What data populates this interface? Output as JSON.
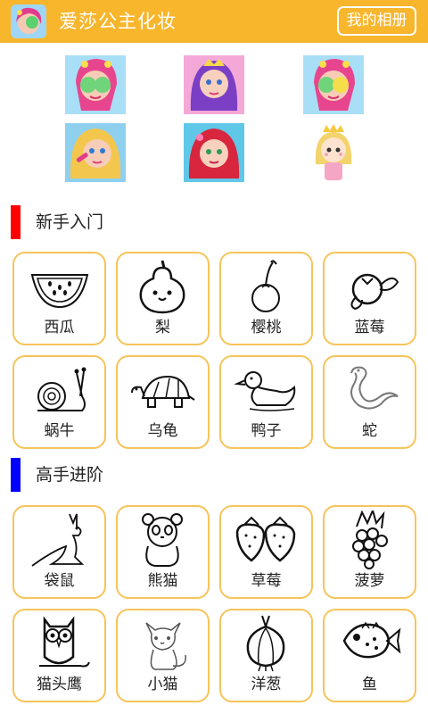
{
  "header": {
    "title": "爱莎公主化妆",
    "album_button": "我的相册"
  },
  "gallery": {
    "thumbnails": [
      {
        "name": "princess-mask-1",
        "icon": "face-mask-princess-icon"
      },
      {
        "name": "princess-purple",
        "icon": "purple-hair-princess-icon"
      },
      {
        "name": "princess-mask-2",
        "icon": "face-mask-princess-icon"
      },
      {
        "name": "princess-makeup",
        "icon": "makeup-princess-icon"
      },
      {
        "name": "princess-red",
        "icon": "red-hair-princess-icon"
      },
      {
        "name": "princess-cartoon",
        "icon": "cartoon-princess-icon"
      }
    ]
  },
  "sections": [
    {
      "title": "新手入门",
      "color": "#ff0000",
      "items": [
        {
          "label": "西瓜",
          "icon": "watermelon-icon"
        },
        {
          "label": "梨",
          "icon": "pear-icon"
        },
        {
          "label": "樱桃",
          "icon": "cherry-icon"
        },
        {
          "label": "蓝莓",
          "icon": "blueberry-icon"
        },
        {
          "label": "蜗牛",
          "icon": "snail-icon"
        },
        {
          "label": "乌龟",
          "icon": "turtle-icon"
        },
        {
          "label": "鸭子",
          "icon": "duck-icon"
        },
        {
          "label": "蛇",
          "icon": "snake-icon"
        }
      ]
    },
    {
      "title": "高手进阶",
      "color": "#0000ff",
      "items": [
        {
          "label": "袋鼠",
          "icon": "kangaroo-icon"
        },
        {
          "label": "熊猫",
          "icon": "panda-icon"
        },
        {
          "label": "草莓",
          "icon": "strawberry-icon"
        },
        {
          "label": "菠萝",
          "icon": "pineapple-icon"
        },
        {
          "label": "猫头鹰",
          "icon": "owl-icon"
        },
        {
          "label": "小猫",
          "icon": "kitten-icon"
        },
        {
          "label": "洋葱",
          "icon": "onion-icon"
        },
        {
          "label": "鱼",
          "icon": "fish-icon"
        }
      ]
    }
  ],
  "colors": {
    "header": "#f8b62d",
    "card_border": "#f6c45a"
  }
}
